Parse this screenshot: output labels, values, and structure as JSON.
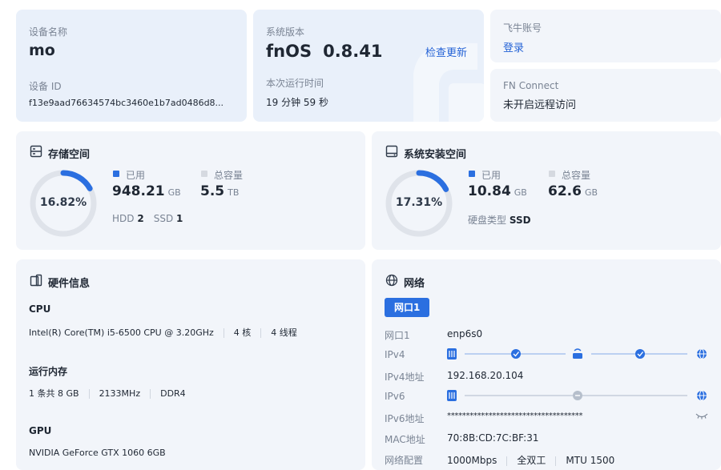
{
  "device": {
    "name_label": "设备名称",
    "name": "mo",
    "id_label": "设备 ID",
    "id": "f13e9aad76634574bc3460e1b7ad0486d8..."
  },
  "system": {
    "version_label": "系统版本",
    "os": "fnOS",
    "version": "0.8.41",
    "check_update": "检查更新",
    "uptime_label": "本次运行时间",
    "uptime": "19 分钟 59 秒"
  },
  "feiniu": {
    "account_label": "飞牛账号",
    "login": "登录"
  },
  "fnconnect": {
    "label": "FN Connect",
    "status": "未开启远程访问"
  },
  "storage": {
    "title": "存储空间",
    "percent_text": "16.82%",
    "percent": 0.1682,
    "used_label": "已用",
    "used_value": "948.21",
    "used_unit": "GB",
    "total_label": "总容量",
    "total_value": "5.5",
    "total_unit": "TB",
    "hdd_label": "HDD",
    "hdd_count": "2",
    "ssd_label": "SSD",
    "ssd_count": "1"
  },
  "sysdisk": {
    "title": "系统安装空间",
    "percent_text": "17.31%",
    "percent": 0.1731,
    "used_label": "已用",
    "used_value": "10.84",
    "used_unit": "GB",
    "total_label": "总容量",
    "total_value": "62.6",
    "total_unit": "GB",
    "disk_type_label": "硬盘类型",
    "disk_type": "SSD"
  },
  "hardware": {
    "title": "硬件信息",
    "cpu_label": "CPU",
    "cpu_model": "Intel(R) Core(TM) i5-6500 CPU @ 3.20GHz",
    "cpu_cores": "4 核",
    "cpu_threads": "4 线程",
    "mem_label": "运行内存",
    "mem_count": "1 条共 8 GB",
    "mem_speed": "2133MHz",
    "mem_type": "DDR4",
    "gpu_label": "GPU",
    "gpu_model": "NVIDIA GeForce GTX 1060 6GB"
  },
  "network": {
    "title": "网络",
    "tab": "网口1",
    "rows": {
      "port_label": "网口1",
      "port_value": "enp6s0",
      "ipv4_label": "IPv4",
      "ipv4addr_label": "IPv4地址",
      "ipv4addr_value": "192.168.20.104",
      "ipv6_label": "IPv6",
      "ipv6addr_label": "IPv6地址",
      "ipv6addr_value": "************************************",
      "mac_label": "MAC地址",
      "mac_value": "70:8B:CD:7C:BF:31",
      "config_label": "网络配置",
      "speed": "1000Mbps",
      "duplex": "全双工",
      "mtu": "MTU 1500"
    }
  },
  "colors": {
    "accent": "#2b6fe0",
    "ring_track": "#dfe3ea",
    "card_bg": "#f2f5fa",
    "card_blue": "#e9f0fa"
  }
}
